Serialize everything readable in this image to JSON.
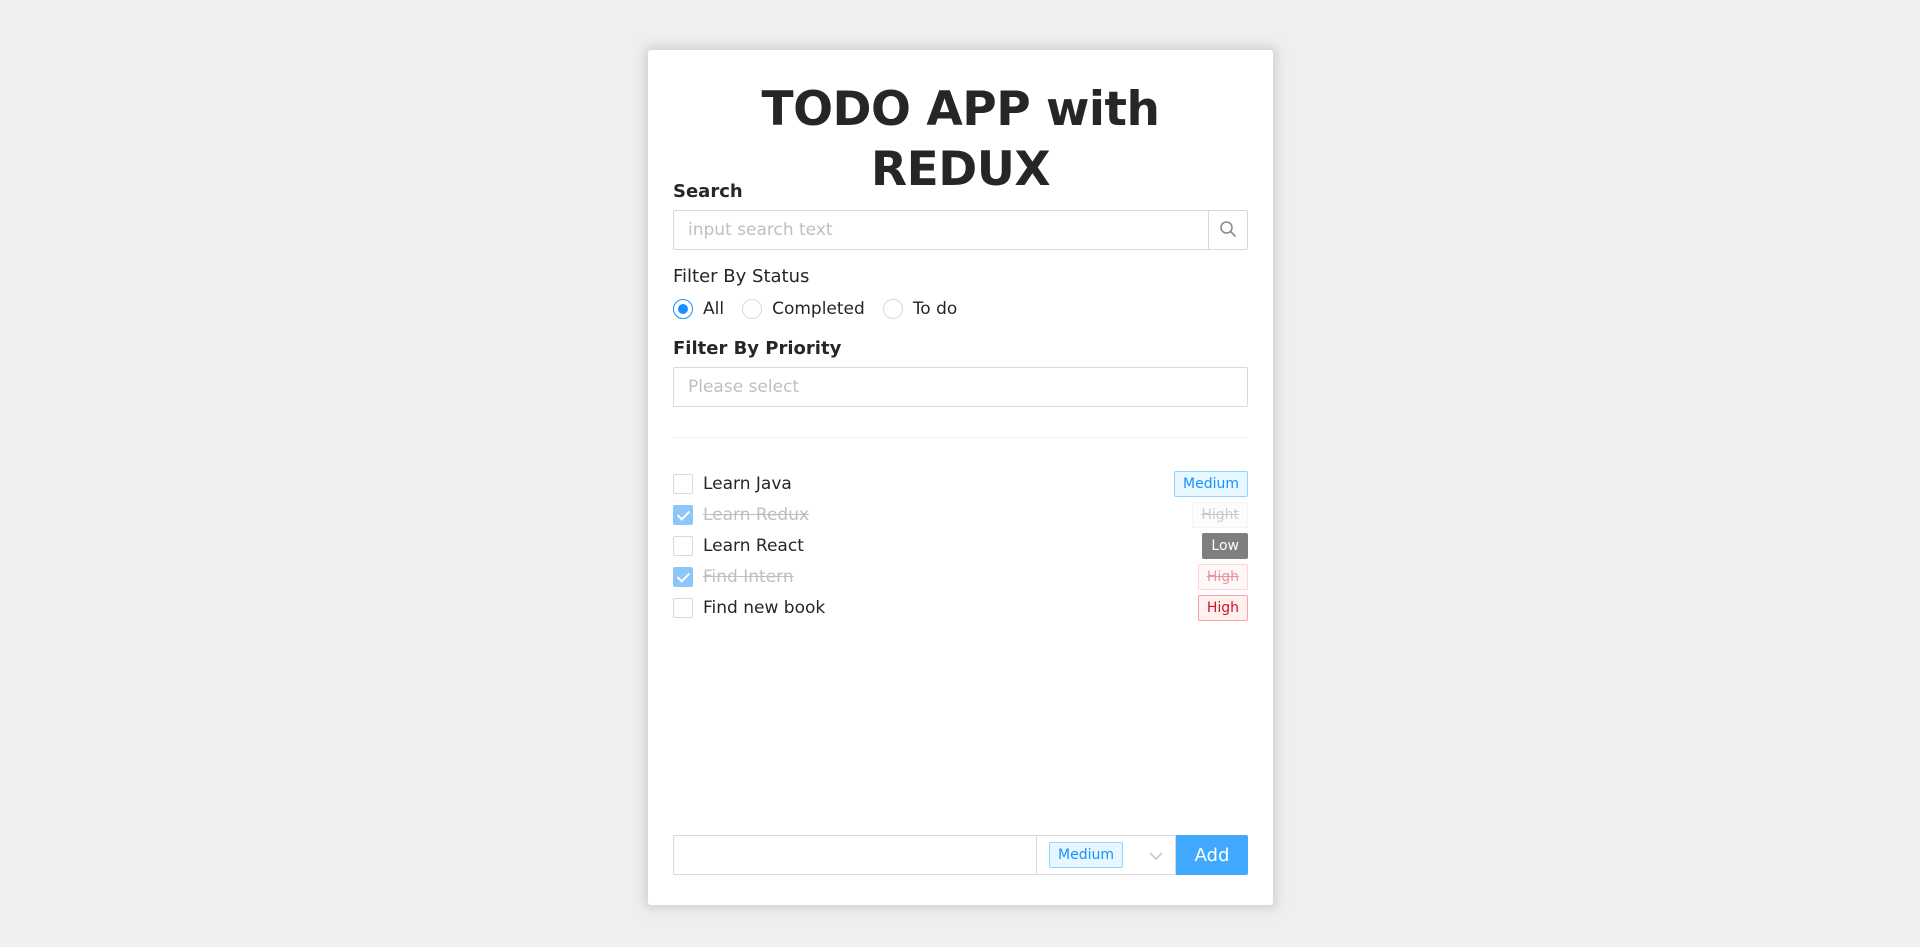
{
  "app": {
    "title": "TODO APP with REDUX"
  },
  "search": {
    "label": "Search",
    "placeholder": "input search text",
    "icon": "search-icon"
  },
  "status_filter": {
    "label": "Filter By Status",
    "options": [
      "All",
      "Completed",
      "To do"
    ],
    "selected": "All"
  },
  "priority_filter": {
    "label": "Filter By Priority",
    "placeholder": "Please select"
  },
  "todos": [
    {
      "name": "Learn Java",
      "completed": false,
      "priority": "Medium"
    },
    {
      "name": "Learn Redux",
      "completed": true,
      "priority": "Hight"
    },
    {
      "name": "Learn React",
      "completed": false,
      "priority": "Low"
    },
    {
      "name": "Find Intern",
      "completed": true,
      "priority": "High"
    },
    {
      "name": "Find new book",
      "completed": false,
      "priority": "High"
    }
  ],
  "add_form": {
    "input_value": "",
    "priority_selected": "Medium",
    "add_label": "Add"
  },
  "colors": {
    "primary": "#1890ff",
    "add_button": "#40a9ff",
    "medium_tag": "#e6f7ff",
    "high_tag": "#fff1f0",
    "low_tag": "#7f7f7f"
  }
}
